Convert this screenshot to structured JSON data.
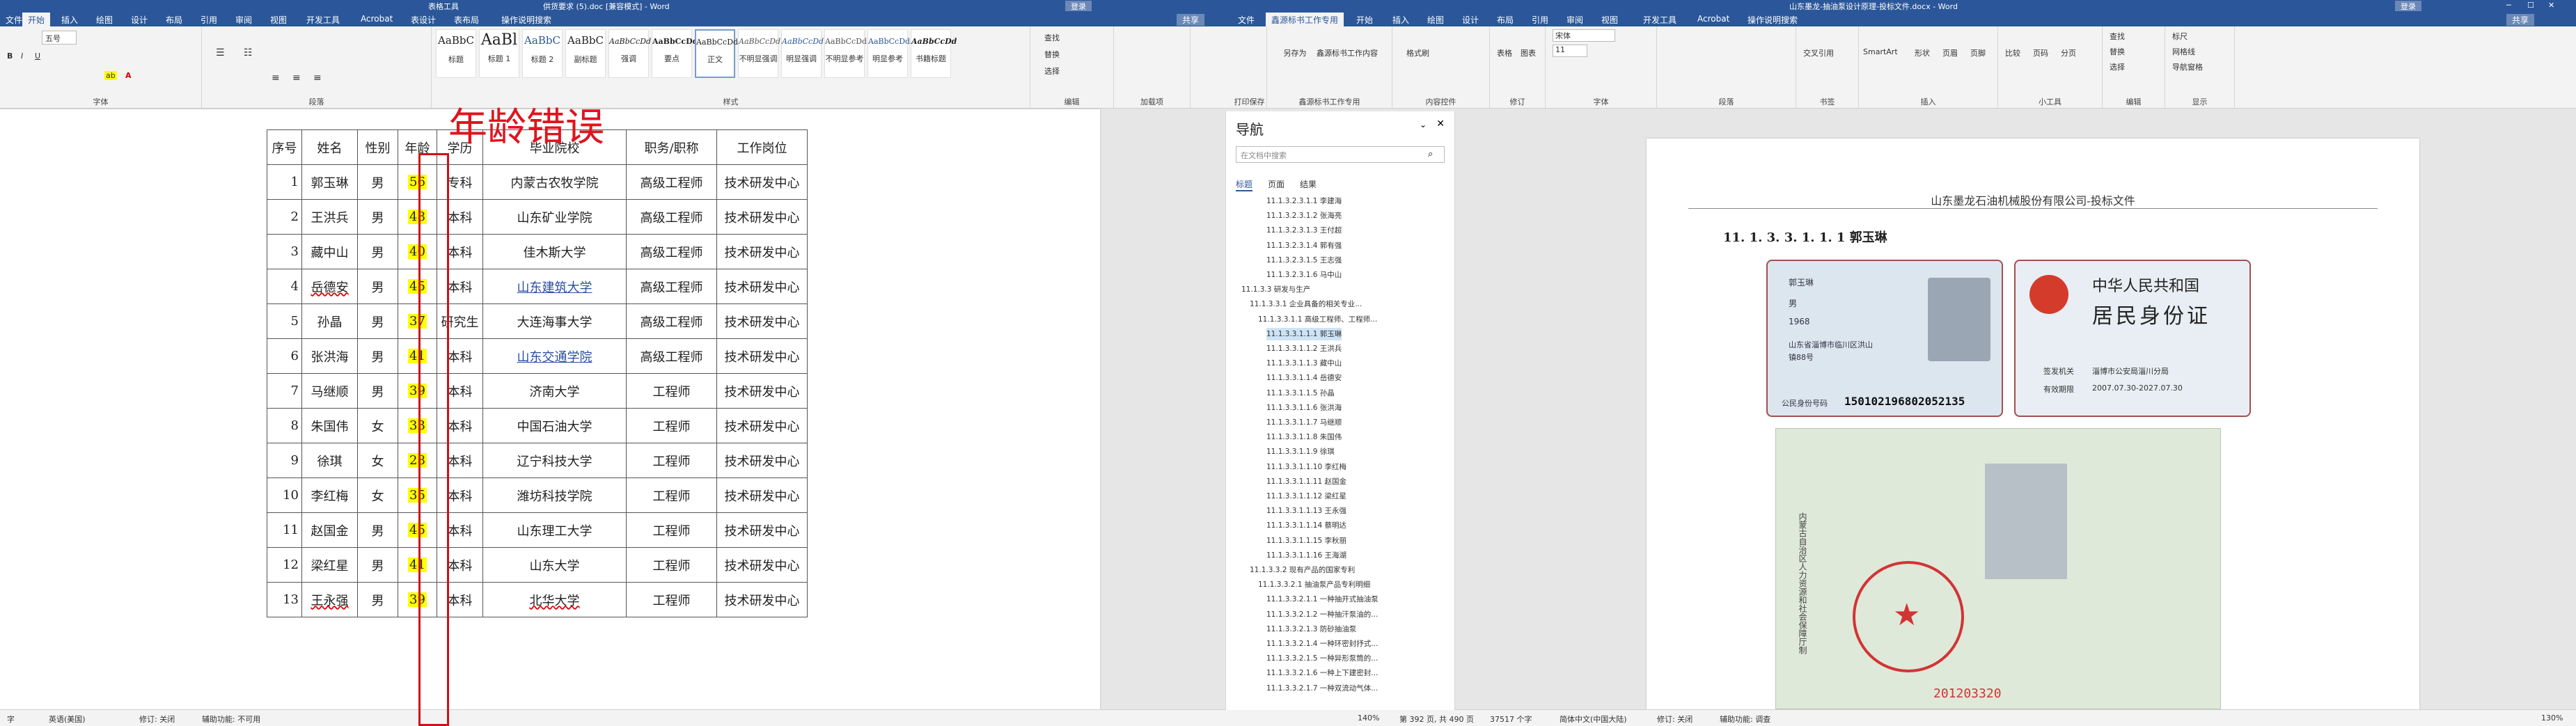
{
  "left": {
    "title_tool": "表格工具",
    "title_doc": "供货要求 (5).doc [兼容模式] - Word",
    "signin": "登录",
    "share": "共享",
    "tabs": [
      "文件",
      "开始",
      "插入",
      "绘图",
      "设计",
      "布局",
      "引用",
      "审阅",
      "视图",
      "开发工具",
      "Acrobat",
      "表设计",
      "表布局",
      "操作说明搜索"
    ],
    "font_size": "五号",
    "groups": {
      "font": "字体",
      "paragraph": "段落",
      "styles": "样式",
      "editing": "编辑",
      "addins": "加载项"
    },
    "styles": [
      {
        "preview": "AaBbC",
        "name": "标题"
      },
      {
        "preview": "AaBl",
        "name": "标题 1"
      },
      {
        "preview": "AaBbC",
        "name": "标题 2"
      },
      {
        "preview": "AaBbC",
        "name": "副标题"
      },
      {
        "preview": "AaBbCcDd",
        "name": "强调"
      },
      {
        "preview": "AaBbCcDd",
        "name": "要点"
      },
      {
        "preview": "AaBbCcDd",
        "name": "正文"
      },
      {
        "preview": "AaBbCcDd",
        "name": "不明显强调"
      },
      {
        "preview": "AaBbCcDd",
        "name": "明显强调"
      },
      {
        "preview": "AaBbCcDd",
        "name": "不明显参考"
      },
      {
        "preview": "AaBbCcDd",
        "name": "明显参考"
      },
      {
        "preview": "AaBbCcDd",
        "name": "书籍标题"
      }
    ],
    "editing": [
      "查找",
      "替换",
      "选择"
    ],
    "table": {
      "headers": [
        "序号",
        "姓名",
        "性别",
        "年龄",
        "学历",
        "毕业院校",
        "职务/职称",
        "工作岗位"
      ],
      "rows": [
        [
          "1",
          "郭玉琳",
          "男",
          "56",
          "专科",
          "内蒙古农牧学院",
          "高级工程师",
          "技术研发中心"
        ],
        [
          "2",
          "王洪兵",
          "男",
          "48",
          "本科",
          "山东矿业学院",
          "高级工程师",
          "技术研发中心"
        ],
        [
          "3",
          "藏中山",
          "男",
          "40",
          "本科",
          "佳木斯大学",
          "高级工程师",
          "技术研发中心"
        ],
        [
          "4",
          "岳德安",
          "男",
          "45",
          "本科",
          "山东建筑大学",
          "高级工程师",
          "技术研发中心"
        ],
        [
          "5",
          "孙晶",
          "男",
          "37",
          "研究生",
          "大连海事大学",
          "高级工程师",
          "技术研发中心"
        ],
        [
          "6",
          "张洪海",
          "男",
          "41",
          "本科",
          "山东交通学院",
          "高级工程师",
          "技术研发中心"
        ],
        [
          "7",
          "马继顺",
          "男",
          "39",
          "本科",
          "济南大学",
          "工程师",
          "技术研发中心"
        ],
        [
          "8",
          "朱国伟",
          "女",
          "33",
          "本科",
          "中国石油大学",
          "工程师",
          "技术研发中心"
        ],
        [
          "9",
          "徐琪",
          "女",
          "28",
          "本科",
          "辽宁科技大学",
          "工程师",
          "技术研发中心"
        ],
        [
          "10",
          "李红梅",
          "女",
          "35",
          "本科",
          "潍坊科技学院",
          "工程师",
          "技术研发中心"
        ],
        [
          "11",
          "赵国金",
          "男",
          "45",
          "本科",
          "山东理工大学",
          "工程师",
          "技术研发中心"
        ],
        [
          "12",
          "梁红星",
          "男",
          "41",
          "本科",
          "山东大学",
          "工程师",
          "技术研发中心"
        ],
        [
          "13",
          "王永强",
          "男",
          "39",
          "本科",
          "北华大学",
          "工程师",
          "技术研发中心"
        ]
      ]
    },
    "annotation": "年龄错误",
    "status": {
      "words": "字",
      "lang": "英语(美国)",
      "track": "修订: 关闭",
      "access": "辅助功能: 不可用"
    }
  },
  "right": {
    "title_doc": "山东墨龙-抽油泵设计原理-投标文件.docx - Word",
    "signin": "登录",
    "share": "共享",
    "tabs": [
      "文件",
      "鑫源标书工作专用",
      "开始",
      "插入",
      "绘图",
      "设计",
      "布局",
      "引用",
      "审阅",
      "视图",
      "开发工具",
      "Acrobat",
      "操作说明搜索"
    ],
    "ribbon_groups": [
      "打印保存",
      "鑫源标书工作专用",
      "内容控件",
      "修订",
      "字体",
      "段落",
      "书签",
      "插入",
      "小工具",
      "编辑",
      "显示"
    ],
    "ribbon_btns": [
      "另存为",
      "鑫源标书工作内容",
      "格式刷",
      "表格",
      "图表",
      "宋体",
      "交叉引用",
      "SmartArt",
      "形状",
      "页眉",
      "页脚",
      "比较",
      "页码",
      "分页",
      "查找",
      "替换",
      "选择",
      "标尺",
      "网格线",
      "导航窗格"
    ],
    "font_name": "宋体",
    "font_size": "11",
    "nav": {
      "title": "导航",
      "search_placeholder": "在文档中搜索",
      "tabs": [
        "标题",
        "页面",
        "结果"
      ],
      "items": [
        "11.1.3.2.3.1.1 李建海",
        "11.1.3.2.3.1.2 张海亮",
        "11.1.3.2.3.1.3 王付超",
        "11.1.3.2.3.1.4 郭有强",
        "11.1.3.2.3.1.5 王志强",
        "11.1.3.2.3.1.6 马中山",
        "11.1.3.3 研发与生产",
        "11.1.3.3.1 企业具备的相关专业...",
        "11.1.3.3.1.1 高级工程师、工程师...",
        "11.1.3.3.1.1.1 郭玉琳",
        "11.1.3.3.1.1.2 王洪兵",
        "11.1.3.3.1.1.3 藏中山",
        "11.1.3.3.1.1.4 岳德安",
        "11.1.3.3.1.1.5 孙晶",
        "11.1.3.3.1.1.6 张洪海",
        "11.1.3.3.1.1.7 马继顺",
        "11.1.3.3.1.1.8 朱国伟",
        "11.1.3.3.1.1.9 徐琪",
        "11.1.3.3.1.1.10 李红梅",
        "11.1.3.3.1.1.11 赵国金",
        "11.1.3.3.1.1.12 梁红星",
        "11.1.3.3.1.1.13 王永强",
        "11.1.3.3.1.1.14 蔡明达",
        "11.1.3.3.1.1.15 李秋丽",
        "11.1.3.3.1.1.16 王海湖",
        "11.1.3.3.2 现有产品的国家专利",
        "11.1.3.3.2.1 抽油泵产品专利明细",
        "11.1.3.3.2.1.1 一种抽开式抽油泵",
        "11.1.3.3.2.1.2 一种抽汗泵油的...",
        "11.1.3.3.2.1.3 防砂抽油泵",
        "11.1.3.3.2.1.4 一种环密封抒式...",
        "11.1.3.3.2.1.5 一种异形泵筒的...",
        "11.1.3.3.2.1.6 一种上下建密封...",
        "11.1.3.3.2.1.7 一种双流动气体..."
      ]
    },
    "page_header": "山东墨龙石油机械股份有限公司-投标文件",
    "heading": "11. 1. 3. 3. 1. 1. 1 郭玉琳",
    "idcard_front": {
      "name": "郭玉琳",
      "sex": "男",
      "year": "1968",
      "address1": "山东省淄博市临川区洪山",
      "address2": "镇88号",
      "id_label": "公民身份号码",
      "id_no": "150102196802052135"
    },
    "idcard_back": {
      "title1": "中华人民共和国",
      "title2": "居民身份证",
      "authority_label": "签发机关",
      "authority": "淄博市公安局淄川分局",
      "valid_label": "有效期限",
      "valid": "2007.07.30-2027.07.30"
    },
    "cert": {
      "issuer": "内蒙古自治区人力资源和社会保障厅制",
      "no": "201203320"
    },
    "status": {
      "page": "第 392 页, 共 490 页",
      "words": "37517 个字",
      "lang": "简体中文(中国大陆)",
      "track": "修订: 关闭",
      "access": "辅助功能: 调查",
      "zoom": "130%",
      "zoomL": "140%"
    }
  }
}
